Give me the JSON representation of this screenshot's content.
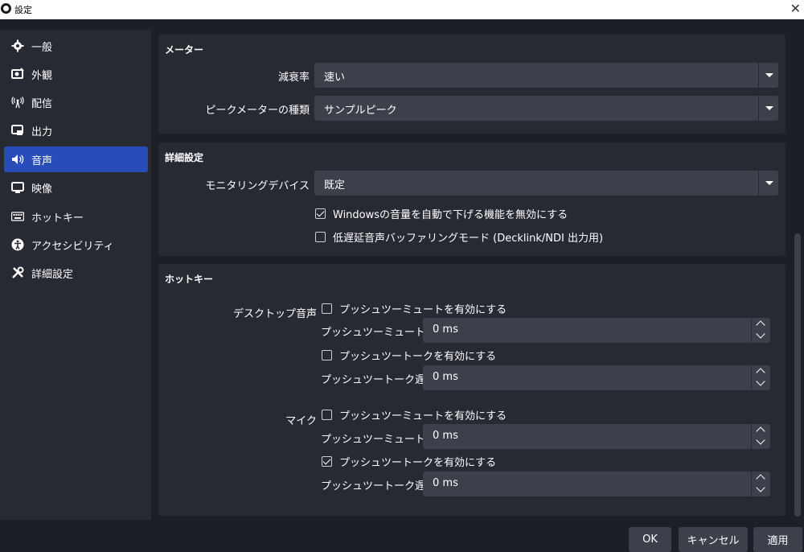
{
  "window": {
    "title": "設定",
    "close_icon": "close-icon"
  },
  "sidebar": {
    "items": [
      {
        "label": "一般",
        "icon": "gear-icon"
      },
      {
        "label": "外観",
        "icon": "appearance-icon"
      },
      {
        "label": "配信",
        "icon": "broadcast-icon"
      },
      {
        "label": "出力",
        "icon": "output-icon"
      },
      {
        "label": "音声",
        "icon": "speaker-icon",
        "active": true
      },
      {
        "label": "映像",
        "icon": "monitor-icon"
      },
      {
        "label": "ホットキー",
        "icon": "keyboard-icon"
      },
      {
        "label": "アクセシビリティ",
        "icon": "accessibility-icon"
      },
      {
        "label": "詳細設定",
        "icon": "tools-icon"
      }
    ]
  },
  "meter": {
    "title": "メーター",
    "decay_label": "減衰率",
    "decay_value": "速い",
    "type_label": "ピークメーターの種類",
    "type_value": "サンプルピーク"
  },
  "advanced": {
    "title": "詳細設定",
    "monitoring_label": "モニタリングデバイス",
    "monitoring_value": "既定",
    "ducking_label": "Windowsの音量を自動で下げる機能を無効にする",
    "ducking_checked": true,
    "lowlatency_label": "低遅延音声バッファリングモード (Decklink/NDI 出力用)",
    "lowlatency_checked": false
  },
  "hotkeys": {
    "title": "ホットキー",
    "desktop": {
      "label": "デスクトップ音声",
      "ptm_label": "プッシュツーミュートを有効にする",
      "ptm_checked": false,
      "ptm_delay_label": "プッシュツーミュート遅延",
      "ptm_delay_value": "0 ms",
      "ptt_label": "プッシュツートークを有効にする",
      "ptt_checked": false,
      "ptt_delay_label": "プッシュツートーク遅延",
      "ptt_delay_value": "0 ms"
    },
    "mic": {
      "label": "マイク",
      "ptm_label": "プッシュツーミュートを有効にする",
      "ptm_checked": false,
      "ptm_delay_label": "プッシュツーミュート遅延",
      "ptm_delay_value": "0 ms",
      "ptt_label": "プッシュツートークを有効にする",
      "ptt_checked": true,
      "ptt_delay_label": "プッシュツートーク遅延",
      "ptt_delay_value": "0 ms"
    }
  },
  "footer": {
    "ok": "OK",
    "cancel": "キャンセル",
    "apply": "適用"
  },
  "colors": {
    "background": "#1d1f26",
    "panel": "#272a33",
    "control": "#3c404b",
    "accent": "#284cb8"
  }
}
